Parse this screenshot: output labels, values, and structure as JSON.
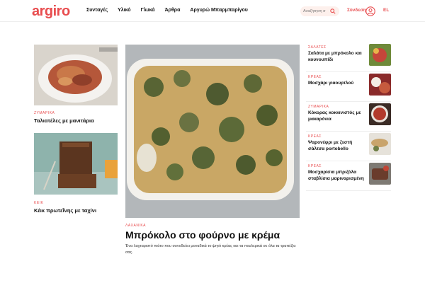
{
  "header": {
    "logo": "argiro",
    "nav": [
      "Συνταγές",
      "Υλικό",
      "Γλυκά",
      "Άρθρα",
      "Αργυρώ Μπαρμπαρίγου"
    ],
    "search_placeholder": "Αναζήτηση σ",
    "login": "Σύνδεση",
    "lang": "EL"
  },
  "colors": {
    "accent": "#e84d4f"
  },
  "left_cards": [
    {
      "category": "ΖΥΜΑΡΙΚΑ",
      "title": "Ταλιατέλες με μανιτάρια"
    },
    {
      "category": "ΚΕΙΚ",
      "title": "Κέικ πρωτεΐνης με ταχίνι"
    }
  ],
  "feature": {
    "category": "ΛΑΧΑΝΙΚΑ",
    "title": "Μπρόκολο στο φούρνο με κρέμα",
    "description": "Ένα λαχταριστό πιάτο που συνοδεύει μοναδικά το ψητό κρέας και τα πουλερικά σε όλα τα τραπέζια σας."
  },
  "right_list": [
    {
      "category": "ΣΑΛΑΤΕΣ",
      "title": "Σαλάτα με μπρόκολο και κουνουπίδι"
    },
    {
      "category": "ΚΡΕΑΣ",
      "title": "Μοσχάρι γιαουρτλού"
    },
    {
      "category": "ΖΥΜΑΡΙΚΑ",
      "title": "Κόκορας κοκκινιστός με μακαρόνια"
    },
    {
      "category": "ΚΡΕΑΣ",
      "title": "Ψαρονέφρι με ζεστή σάλτσα portobello"
    },
    {
      "category": "ΚΡΕΑΣ",
      "title": "Μοσχαρίσια μπριζόλα σταβλίσια μαριναρισμένη"
    }
  ]
}
